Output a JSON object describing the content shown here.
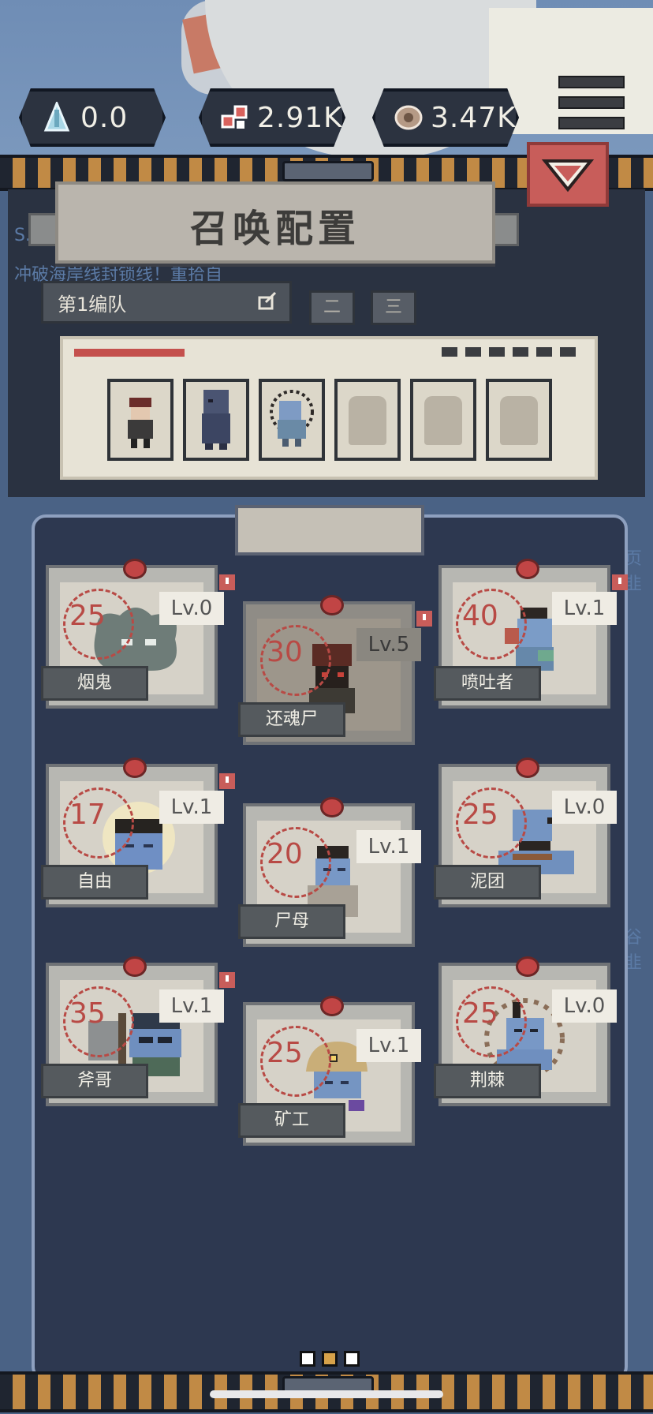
{
  "resources": [
    {
      "icon": "crystal-icon",
      "value": "0.0"
    },
    {
      "icon": "meat-icon",
      "value": "2.91K"
    },
    {
      "icon": "scroll-icon",
      "value": "3.47K"
    }
  ],
  "panel": {
    "title": "召唤配置",
    "bg_text_1": "S.O",
    "bg_text_2": "冲破海岸线封锁线！重拾自",
    "bg_text_3": "页韭",
    "bg_text_4": "谷韭"
  },
  "squads": {
    "selected": "第1编队",
    "tabs": [
      "二",
      "三"
    ]
  },
  "roster": {
    "slots_filled": 3,
    "slots_total": 6
  },
  "cards": [
    {
      "name": "烟鬼",
      "cost": "25",
      "level": "Lv.0",
      "alert": true
    },
    {
      "name": "还魂尸",
      "cost": "30",
      "level": "Lv.5",
      "alert": true
    },
    {
      "name": "喷吐者",
      "cost": "40",
      "level": "Lv.1",
      "alert": true
    },
    {
      "name": "自由",
      "cost": "17",
      "level": "Lv.1",
      "alert": true
    },
    {
      "name": "尸母",
      "cost": "20",
      "level": "Lv.1",
      "alert": false
    },
    {
      "name": "泥团",
      "cost": "25",
      "level": "Lv.0",
      "alert": false
    },
    {
      "name": "斧哥",
      "cost": "35",
      "level": "Lv.1",
      "alert": true
    },
    {
      "name": "矿工",
      "cost": "25",
      "level": "Lv.1",
      "alert": false
    },
    {
      "name": "荆棘",
      "cost": "25",
      "level": "Lv.0",
      "alert": false
    }
  ],
  "pagination": {
    "current": 2,
    "total": 3
  },
  "colors": {
    "accent": "#c85d5a",
    "gold": "#c18a45",
    "panel": "#2d3850"
  }
}
